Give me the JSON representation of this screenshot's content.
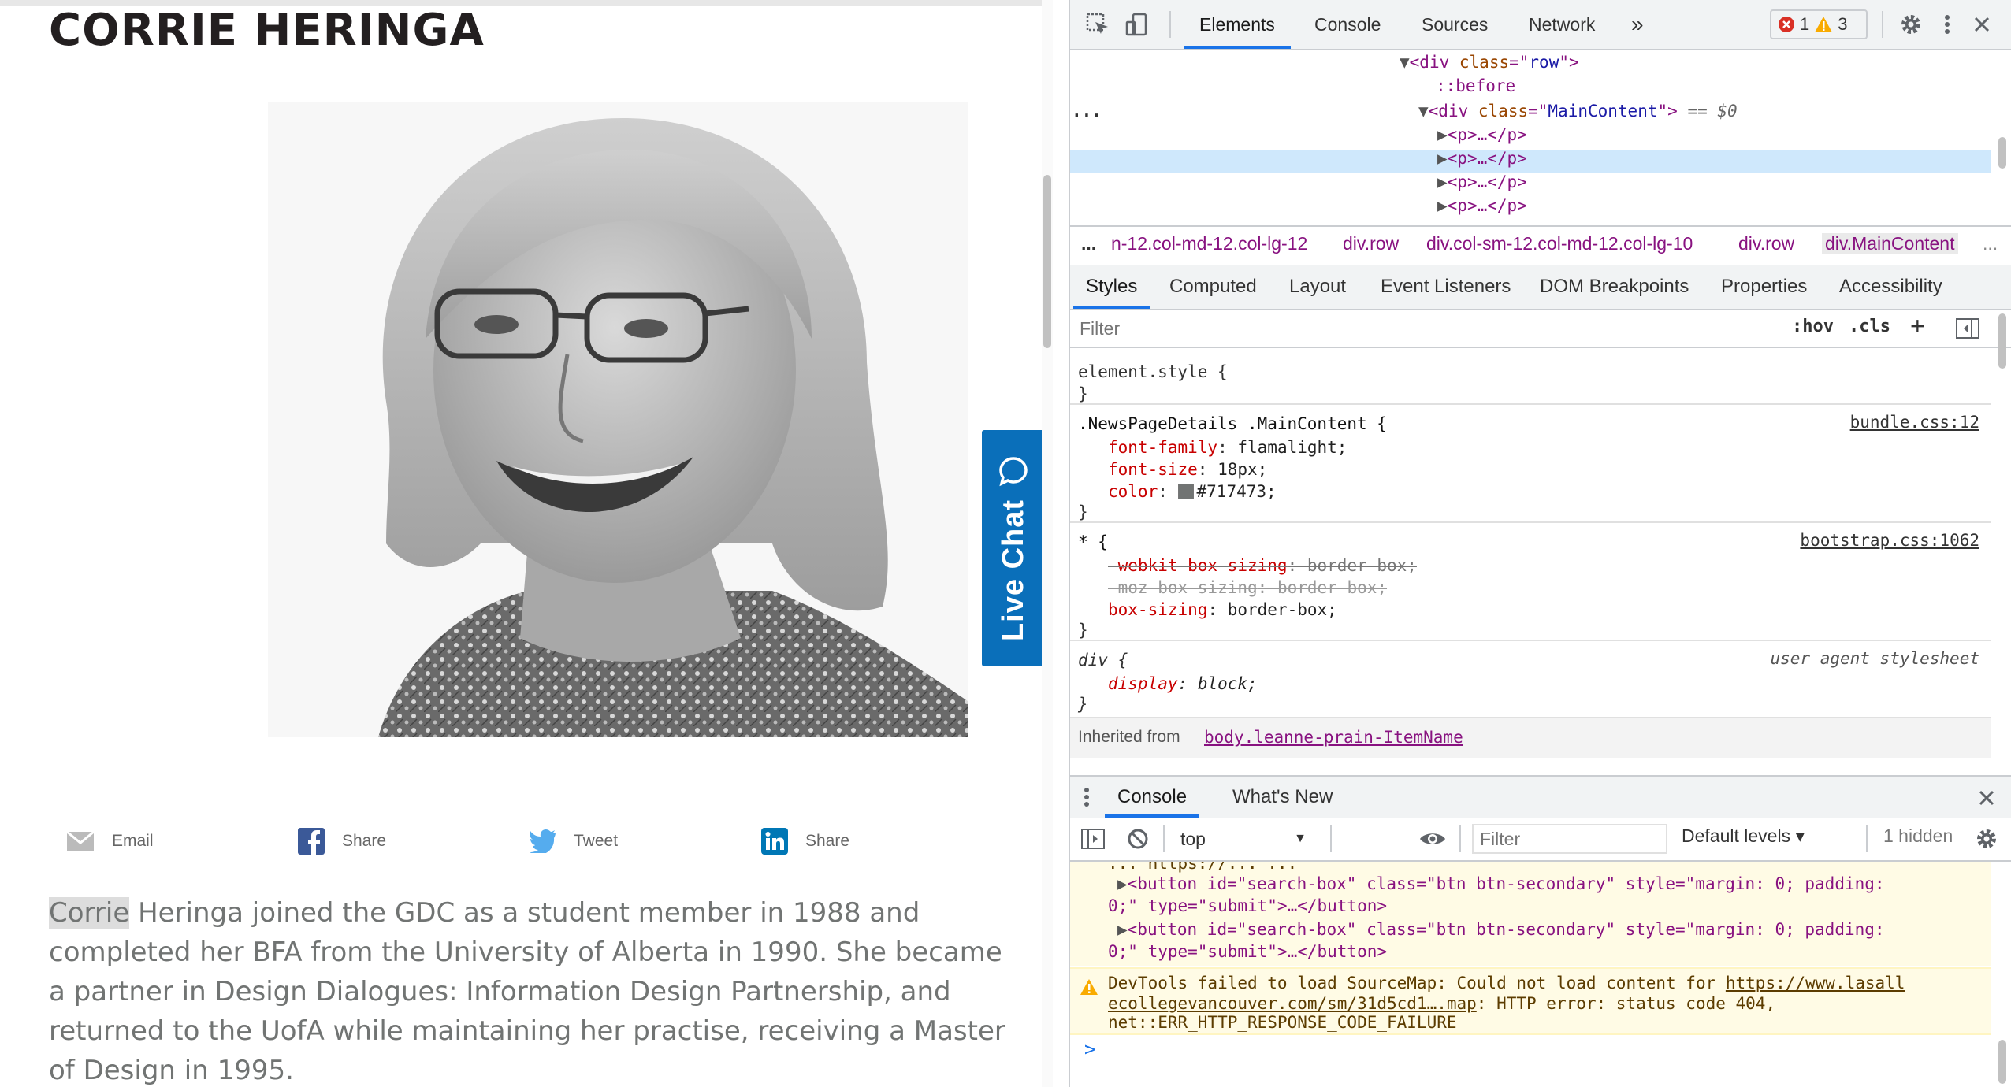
{
  "page": {
    "title": "CORRIE HERINGA",
    "share": {
      "email": "Email",
      "facebook": "Share",
      "twitter": "Tweet",
      "linkedin": "Share"
    },
    "bio_highlight": "Corrie",
    "bio_rest": " Heringa joined the GDC as a student member in 1988 and completed her BFA from the University of Alberta in 1990. She became a partner in Design Dialogues: Information Design Partnership, and returned to the UofA while maintaining her practise, receiving a Master of Design in 1995.",
    "live_chat": "Live Chat"
  },
  "devtools": {
    "tabs": [
      "Elements",
      "Console",
      "Sources",
      "Network"
    ],
    "more_tabs": "»",
    "errors": "1",
    "warnings": "3",
    "dom": {
      "row_line": [
        "<div",
        "class",
        "=\"",
        "row",
        "\">"
      ],
      "before": "::before",
      "main_open": "<div",
      "main_attr": "class",
      "main_val": "MainContent",
      "main_suffix": "== $0",
      "p_line": "<p>…</p>",
      "ellipsis": "..."
    },
    "breadcrumbs": [
      "...",
      "n-12.col-md-12.col-lg-12",
      "div.row",
      "div.col-sm-12.col-md-12.col-lg-10",
      "div.row",
      "div.MainContent",
      "..."
    ],
    "styles_tabs": [
      "Styles",
      "Computed",
      "Layout",
      "Event Listeners",
      "DOM Breakpoints",
      "Properties",
      "Accessibility"
    ],
    "styles_filter_placeholder": "Filter",
    "hov": ":hov",
    "cls": ".cls",
    "rules": {
      "element_style": "element.style {",
      "close": "}",
      "r1_selector": ".NewsPageDetails .MainContent {",
      "r1_source": "bundle.css:12",
      "r1_p1": "font-family",
      "r1_v1": "flamalight;",
      "r1_p2": "font-size",
      "r1_v2": "18px;",
      "r1_p3": "color",
      "r1_v3": "#717473;",
      "r2_selector": "* {",
      "r2_source": "bootstrap.css:1062",
      "r2_p1": "-webkit-box-sizing",
      "r2_v1": "border-box;",
      "r2_p2": "-moz-box-sizing",
      "r2_v2": "border-box;",
      "r2_p3": "box-sizing",
      "r2_v3": "border-box;",
      "r3_selector": "div",
      "r3_open": " {",
      "r3_source": "user agent stylesheet",
      "r3_p1": "display",
      "r3_v1": "block;",
      "inherited": "Inherited from",
      "inherited_el": "body.leanne-prain-ItemName"
    },
    "drawer_tabs": [
      "Console",
      "What's New"
    ],
    "console": {
      "context": "top",
      "filter_placeholder": "Filter",
      "levels": "Default levels ▾",
      "hidden": "1 hidden",
      "partial": "... https://... ...",
      "btn1_a": "<button id=\"search-box\" class=\"btn btn-secondary\" style=\"margin: 0; padding:",
      "btn1_b": "0;\" type=\"submit\">…</button>",
      "btn2_a": "<button id=\"search-box\" class=\"btn btn-secondary\" style=\"margin: 0; padding:",
      "btn2_b": "0;\" type=\"submit\">…</button>",
      "warn_a": "DevTools failed to load SourceMap: Could not load content for ",
      "warn_link1": "https://www.lasall",
      "warn_link2": "ecollegevancouver.com/sm/31d5cd1….map",
      "warn_b": ": HTTP error: status code 404,",
      "warn_c": "net::ERR_HTTP_RESPONSE_CODE_FAILURE",
      "prompt": ">"
    }
  }
}
